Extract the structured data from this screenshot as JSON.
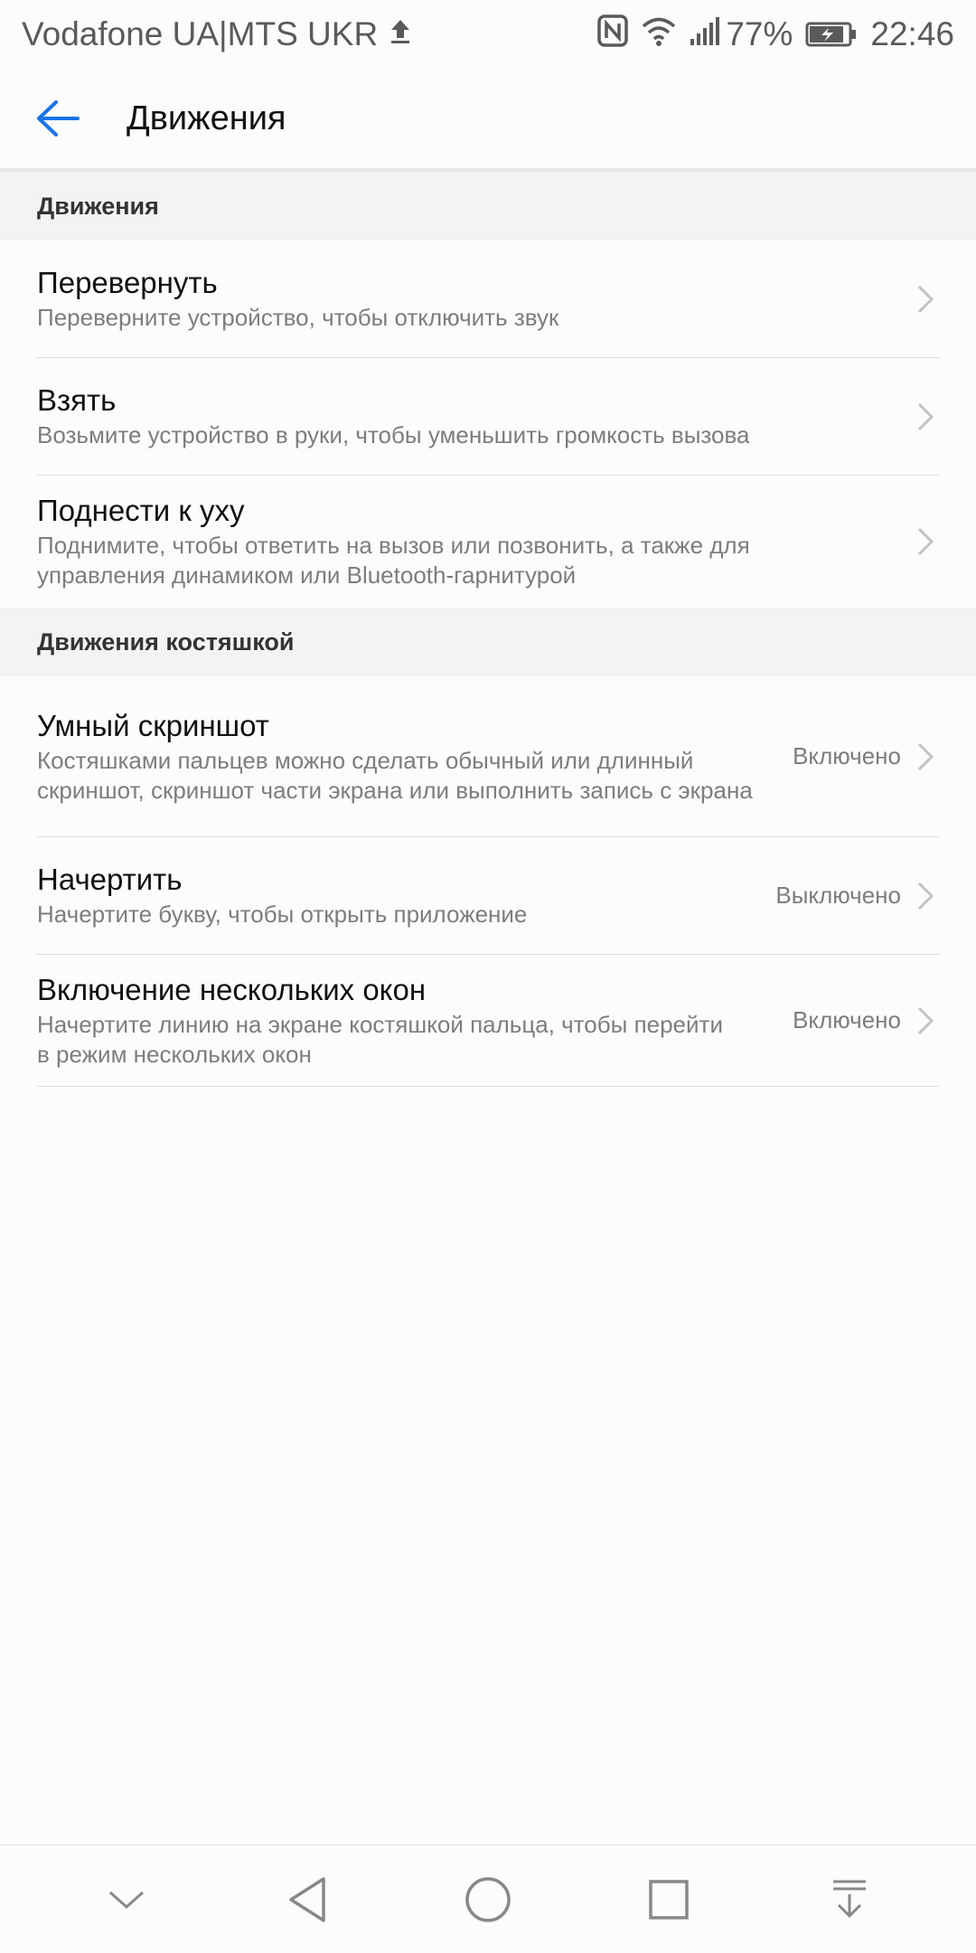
{
  "status_bar": {
    "carrier": "Vodafone UA|MTS UKR",
    "battery_percent": "77%",
    "time": "22:46",
    "icons": [
      "upload-icon",
      "nfc-icon",
      "wifi-icon",
      "signal-icon",
      "battery-charging-icon"
    ]
  },
  "app_bar": {
    "title": "Движения",
    "back_icon": "back-arrow-icon",
    "accent_color": "#1a73e8"
  },
  "sections": [
    {
      "header": "Движения",
      "items": [
        {
          "title": "Перевернуть",
          "subtitle": "Переверните устройство, чтобы отключить звук",
          "status": ""
        },
        {
          "title": "Взять",
          "subtitle": "Возьмите устройство в руки, чтобы уменьшить громкость вызова",
          "status": ""
        },
        {
          "title": "Поднести к уху",
          "subtitle": "Поднимите, чтобы ответить на вызов или позвонить, а также для управления динамиком или Bluetooth-гарнитурой",
          "status": ""
        }
      ]
    },
    {
      "header": "Движения костяшкой",
      "items": [
        {
          "title": "Умный скриншот",
          "subtitle": "Костяшками пальцев можно сделать обычный или длинный скриншот, скриншот части экрана или выполнить запись с экрана",
          "status": "Включено"
        },
        {
          "title": "Начертить",
          "subtitle": "Начертите букву, чтобы открыть приложение",
          "status": "Выключено"
        },
        {
          "title": "Включение нескольких окон",
          "subtitle": "Начертите линию на экране костяшкой пальца, чтобы перейти в режим нескольких окон",
          "status": "Включено"
        }
      ]
    }
  ],
  "nav_bar": {
    "buttons": [
      "collapse-chevron-icon",
      "back-triangle-icon",
      "home-circle-icon",
      "recents-square-icon",
      "notification-pull-icon"
    ]
  }
}
